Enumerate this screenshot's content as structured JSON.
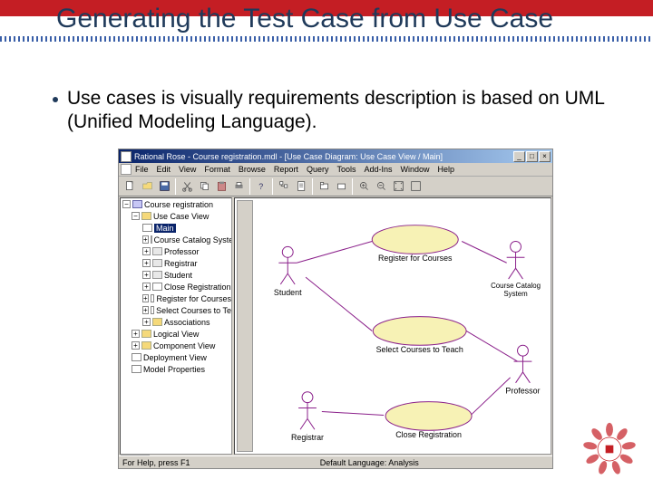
{
  "slide": {
    "title": "Generating the Test Case from Use Case",
    "bullet": "Use cases is visually requirements description  is based on UML (Unified Modeling Language)."
  },
  "app": {
    "title": "Rational Rose - Course registration.mdl - [Use Case Diagram: Use Case View / Main]",
    "winbuttons": {
      "min": "_",
      "max": "□",
      "close": "×"
    },
    "menus": [
      "File",
      "Edit",
      "View",
      "Format",
      "Browse",
      "Report",
      "Query",
      "Tools",
      "Add-Ins",
      "Window",
      "Help"
    ],
    "tree": {
      "root": "Course registration",
      "usecase_view": "Use Case View",
      "main": "Main",
      "items": [
        "Course Catalog Syste",
        "Professor",
        "Registrar",
        "Student",
        "Close Registration",
        "Register for Courses",
        "Select Courses to Te"
      ],
      "assoc": "Associations",
      "views": [
        "Logical View",
        "Component View",
        "Deployment View",
        "Model Properties"
      ]
    },
    "diagram": {
      "actors": {
        "student": "Student",
        "registrar": "Registrar",
        "ccs": "Course Catalog\nSystem",
        "professor": "Professor"
      },
      "usecases": {
        "register": "Register for Courses",
        "select": "Select Courses to Teach",
        "close": "Close Registration"
      }
    },
    "status": {
      "left": "For Help, press F1",
      "mid": "Default Language: Analysis"
    }
  }
}
